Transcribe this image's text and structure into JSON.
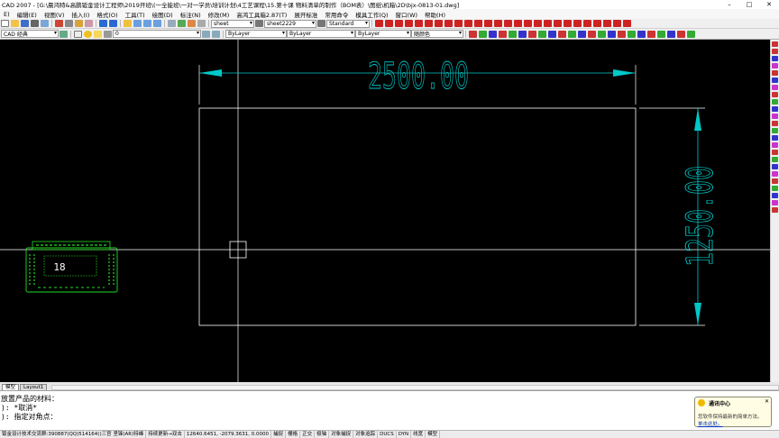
{
  "title": {
    "text": "CAD 2007 - [G:\\晨鸿特&高鹏钣金设计工程师\\2019开班\\(一全能班\\一对一学员\\培训计划\\4工艺课程\\15.第十课 物料清单的制作（BOM表）\\图纸\\机箱\\2D\\bjx-0813-01.dwg]",
    "minimize": "–",
    "maximize": "□",
    "close": "✕"
  },
  "menu": [
    "E)",
    "编辑(E)",
    "视图(V)",
    "插入(I)",
    "格式(O)",
    "工具(T)",
    "绘图(D)",
    "标注(N)",
    "修改(M)",
    "高鸿工具箱2.87(T)",
    "展开标准",
    "常用命令",
    "模具工作(Q)",
    "窗口(W)",
    "帮助(H)"
  ],
  "toolbar": {
    "workspace": "CAD 经典",
    "layer": "0",
    "text_style": "sheet",
    "dim_style": "sheet2229",
    "table_style": "Standard",
    "color": "ByLayer",
    "linetype": "ByLayer",
    "lineweight": "ByLayer",
    "plotstyle": "随颜色"
  },
  "drawing": {
    "dim_horizontal": "2500.00",
    "dim_vertical": "1250.00",
    "block_label": "18",
    "colors": {
      "background": "#000000",
      "lines": "#ffffff",
      "dimension": "#00c8c8",
      "block": "#22dd22"
    }
  },
  "layout_tabs": [
    "模型",
    "Layout1"
  ],
  "command": {
    "line1": "放置产品的材料：",
    "line2": "*取消*",
    "line3": "指定对角点：",
    "prefix2": "):",
    "prefix3": "):"
  },
  "status": {
    "left": "钣金设计技术交流群:390887(QQ)514164()三官 坚锋(AR)特峰",
    "hint": "持续更新→双击",
    "coords": "12640.6451, -2079.3631, 0.0000",
    "toggles": [
      "捕捉",
      "栅格",
      "正交",
      "极轴",
      "对象捕捉",
      "对象追踪",
      "DUCS",
      "DYN",
      "线宽",
      "模型"
    ]
  },
  "notification": {
    "title": "通讯中心",
    "body": "您软件保持最新的简单方法。",
    "link": "单击此处。",
    "close": "✕"
  }
}
